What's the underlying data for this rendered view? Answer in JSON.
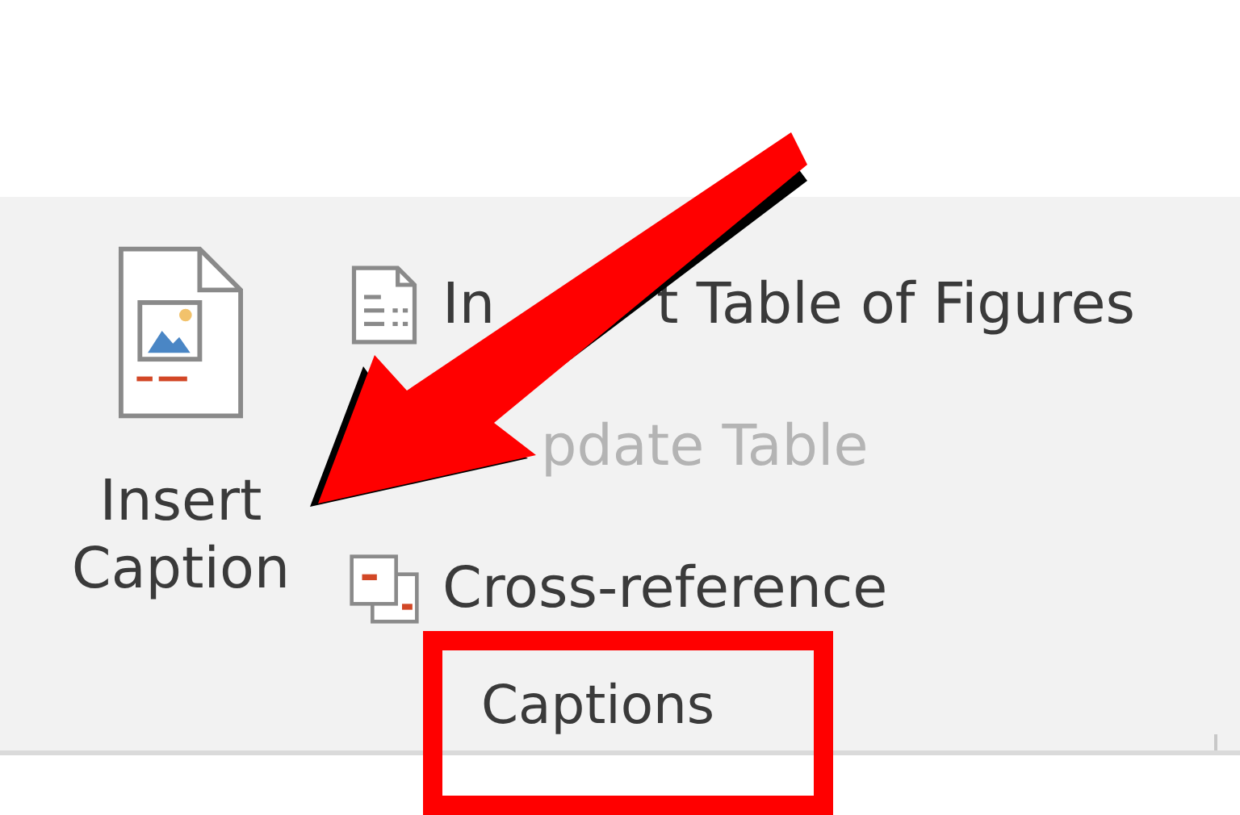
{
  "ribbon_group": {
    "label": "Captions",
    "large_button": {
      "label": "Insert Caption",
      "disabled": false
    },
    "small_buttons": [
      {
        "kind": "table-of-figures",
        "label_parts": [
          "In",
          "t Table of Figures"
        ],
        "disabled": false
      },
      {
        "kind": "update",
        "label_parts": [
          "pdate Table"
        ],
        "disabled": true
      },
      {
        "kind": "cross-reference",
        "label_parts": [
          "Cross-reference"
        ],
        "disabled": false
      }
    ]
  }
}
